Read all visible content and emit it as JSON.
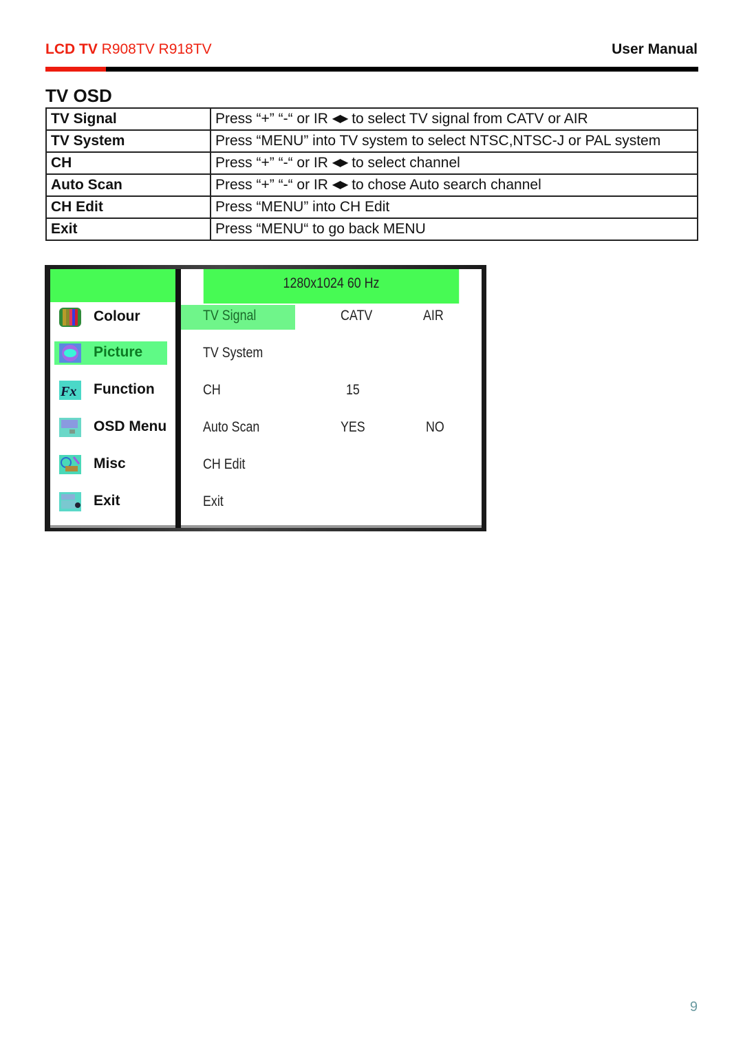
{
  "header": {
    "brand_bold": "LCD TV",
    "models": " R908TV R918TV",
    "doc_type": "User Manual",
    "accent_color": "#ee1c0e"
  },
  "section_title": "TV OSD",
  "spec_table": {
    "rows": [
      {
        "item": "TV Signal",
        "pre": "Press “+” “-“ or IR ",
        "arrows": "◀▶",
        "post": " to select TV signal from CATV or AIR"
      },
      {
        "item": "TV System",
        "pre": "Press “MENU” into TV system to select NTSC,NTSC-J or PAL system",
        "arrows": "",
        "post": ""
      },
      {
        "item": "CH",
        "pre": "Press “+” “-“ or IR ",
        "arrows": "◀▶",
        "post": " to select channel"
      },
      {
        "item": "Auto Scan",
        "pre": "Press “+” “-“ or IR ",
        "arrows": "◀▶",
        "post": " to chose Auto search channel"
      },
      {
        "item": "CH Edit",
        "pre": "Press “MENU” into CH Edit",
        "arrows": "",
        "post": ""
      },
      {
        "item": "Exit",
        "pre": "Press “MENU“ to go back MENU",
        "arrows": "",
        "post": ""
      }
    ]
  },
  "osd": {
    "resolution_banner": "1280x1024   60 Hz",
    "highlight_color": "#47fa54",
    "main_menu": [
      {
        "label": "Colour",
        "icon": "colour-bars-icon",
        "active": false
      },
      {
        "label": "Picture",
        "icon": "picture-gear-icon",
        "active": true
      },
      {
        "label": "Function",
        "icon": "fx-function-icon",
        "active": false
      },
      {
        "label": "OSD Menu",
        "icon": "osd-menu-icon",
        "active": false
      },
      {
        "label": "Misc",
        "icon": "misc-icon",
        "active": false
      },
      {
        "label": "Exit",
        "icon": "exit-icon",
        "active": false
      }
    ],
    "sub_menu": [
      {
        "name": "TV  Signal",
        "v1": "CATV",
        "v2": "AIR",
        "active": true
      },
      {
        "name": "TV  System",
        "v1": "",
        "v2": "",
        "active": false
      },
      {
        "name": "CH",
        "v1": "15",
        "v2": "",
        "active": false
      },
      {
        "name": "Auto  Scan",
        "v1": "YES",
        "v2": "NO",
        "active": false
      },
      {
        "name": "CH  Edit",
        "v1": "",
        "v2": "",
        "active": false
      },
      {
        "name": "Exit",
        "v1": "",
        "v2": "",
        "active": false
      }
    ]
  },
  "page_number": "9"
}
